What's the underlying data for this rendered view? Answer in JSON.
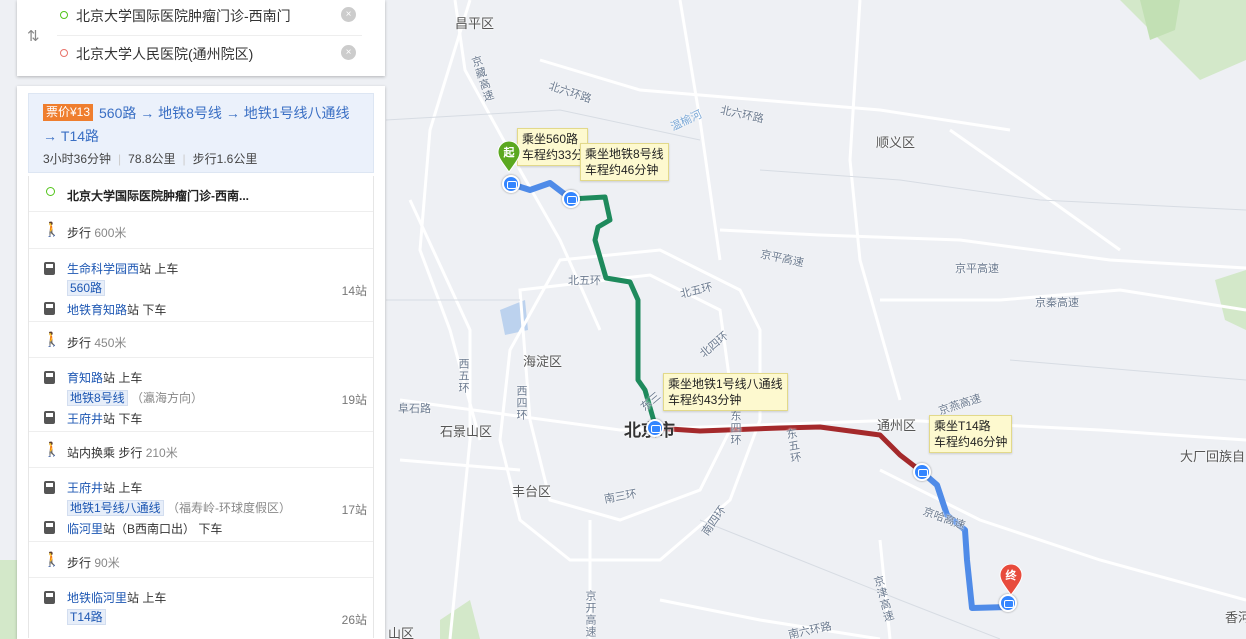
{
  "search": {
    "origin": "北京大学国际医院肿瘤门诊-西南门",
    "destination": "北京大学人民医院(通州院区)",
    "clear_label": "×"
  },
  "summary": {
    "price_badge": "票价¥13",
    "route": "560路 → 地铁8号线 → 地铁1号线八通线 → T14路",
    "duration": "3小时36分钟",
    "distance": "78.8公里",
    "walk": "步行1.6公里"
  },
  "steps": {
    "origin": "北京大学国际医院肿瘤门诊-西南...",
    "walk1": {
      "label": "步行",
      "dist": "600米"
    },
    "seg1": {
      "board_stop": "生命科学园西",
      "board": "站 上车",
      "line": "560路",
      "stops": "14站",
      "alight_stop": "地铁育知路",
      "alight": "站 下车"
    },
    "walk2": {
      "label": "步行",
      "dist": "450米"
    },
    "seg2": {
      "board_stop": "育知路",
      "board": "站 上车",
      "line": "地铁8号线",
      "dir": "（瀛海方向）",
      "stops": "19站",
      "alight_stop": "王府井",
      "alight": "站 下车"
    },
    "walk3": {
      "label": "站内换乘 步行",
      "dist": "210米"
    },
    "seg3": {
      "board_stop": "王府井",
      "board": "站 上车",
      "line": "地铁1号线八通线",
      "dir": "（福寿岭-环球度假区）",
      "stops": "17站",
      "alight_stop": "临河里",
      "alight": "站（B西南口出） 下车"
    },
    "walk4": {
      "label": "步行",
      "dist": "90米"
    },
    "seg4": {
      "board_stop": "地铁临河里",
      "board": "站 上车",
      "line": "T14路",
      "stops": "26站"
    }
  },
  "map": {
    "labels": {
      "changping": "昌平区",
      "shunyi": "顺义区",
      "haidian": "海淀区",
      "beijing": "北京市",
      "shijingshan": "石景山区",
      "fengtai": "丰台区",
      "tongzhou": "通州区",
      "dachang": "大厂回族自",
      "xiangtan": "香河",
      "yuquan": "山区"
    },
    "roads": {
      "jingzang": "京藏高速",
      "beiliuhuan1": "北六环路",
      "beiliuhuan2": "北六环路",
      "beiwuhuan": "北五环",
      "beiwuhuan2": "北五环",
      "beisihuan": "北四环",
      "jingping": "京平高速",
      "jingping2": "京平高速",
      "jingqin": "京秦高速",
      "xiwuhuan": "西五环",
      "xisihuan": "西四环",
      "fushilu": "阜石路",
      "dongsihuan": "东四环",
      "dongwuhuan": "东五环",
      "jingha": "京哈高速",
      "jingyan": "京燕高速",
      "nansanhuan": "南三环",
      "nansihuan": "南四环",
      "jingkai": "京开高速",
      "jingjin": "京津高速",
      "nanliuhuan": "南六环路",
      "dongshi": "东三"
    },
    "river": "温榆河",
    "tips": [
      {
        "line1": "乘坐560路",
        "line2": "车程约33分"
      },
      {
        "line1": "乘坐地铁8号线",
        "line2": "车程约46分钟"
      },
      {
        "line1": "乘坐地铁1号线八通线",
        "line2": "车程约43分钟"
      },
      {
        "line1": "乘坐T14路",
        "line2": "车程约46分钟"
      }
    ],
    "start_pin": "起",
    "end_pin": "终",
    "route_colors": {
      "bus": "#4f8be8",
      "line8": "#1e8a5c",
      "line1": "#a4292b"
    }
  }
}
